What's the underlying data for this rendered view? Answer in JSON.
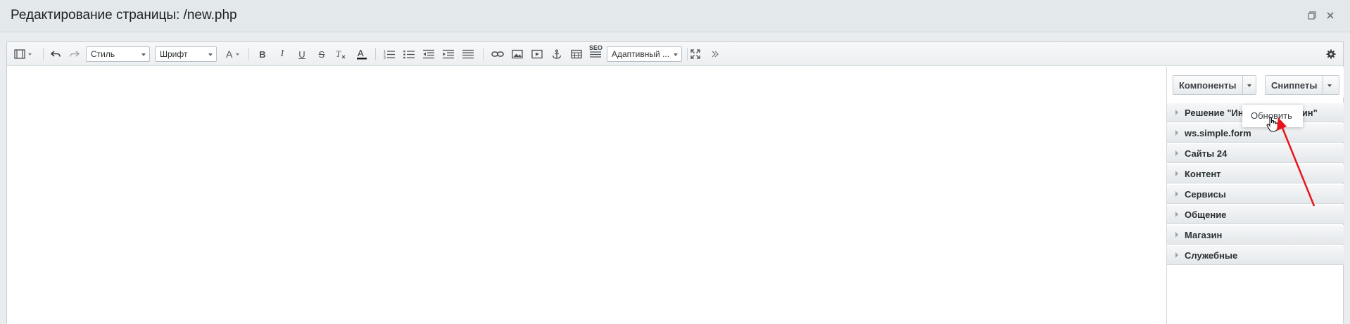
{
  "window": {
    "title": "Редактирование страницы: /new.php",
    "restore_icon": "restore-window-icon",
    "close_icon": "close-icon"
  },
  "toolbar": {
    "style_select": "Стиль",
    "font_select": "Шрифт",
    "adaptive_select": "Адаптивный ...",
    "seo_label": "SEO"
  },
  "side_panel": {
    "components_label": "Компоненты",
    "snippets_label": "Сниппеты",
    "categories": [
      "Решение \"Интернет-магазин\"",
      "ws.simple.form",
      "Сайты 24",
      "Контент",
      "Сервисы",
      "Общение",
      "Магазин",
      "Служебные"
    ],
    "dropdown_item": "Обновить"
  },
  "colors": {
    "annotation_arrow": "#e8141b",
    "title_bar": "#e3e8eb"
  }
}
